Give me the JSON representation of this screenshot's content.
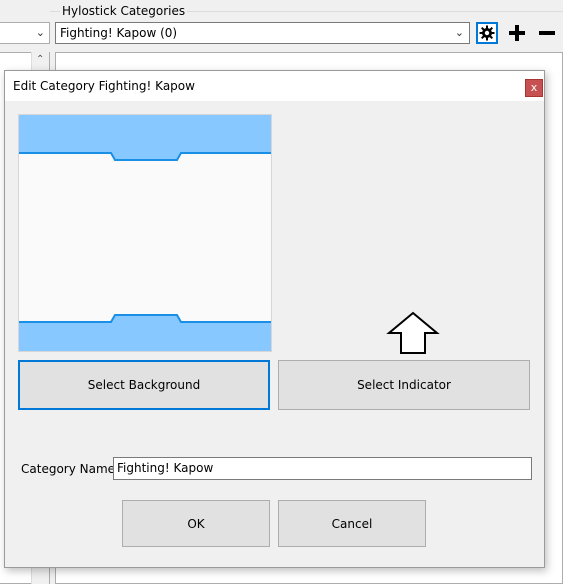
{
  "main_window": {
    "group_title": "Hylostick Categories",
    "category_selected": "Fighting! Kapow (0)",
    "icons": [
      "chevron-down-icon",
      "gear-icon",
      "plus-icon",
      "minus-icon",
      "chevron-up-icon"
    ]
  },
  "dialog": {
    "title": "Edit Category Fighting! Kapow",
    "close_label": "x",
    "select_background_label": "Select Background",
    "select_indicator_label": "Select Indicator",
    "category_name_label": "Category Name",
    "category_name_value": "Fighting! Kapow",
    "ok_label": "OK",
    "cancel_label": "Cancel",
    "indicator_icon": "up-arrow-outline-icon"
  },
  "colors": {
    "accent": "#0078d7",
    "preview_band": "#86c8ff",
    "preview_edge": "#1a8fe6",
    "close_button": "#c75050"
  }
}
